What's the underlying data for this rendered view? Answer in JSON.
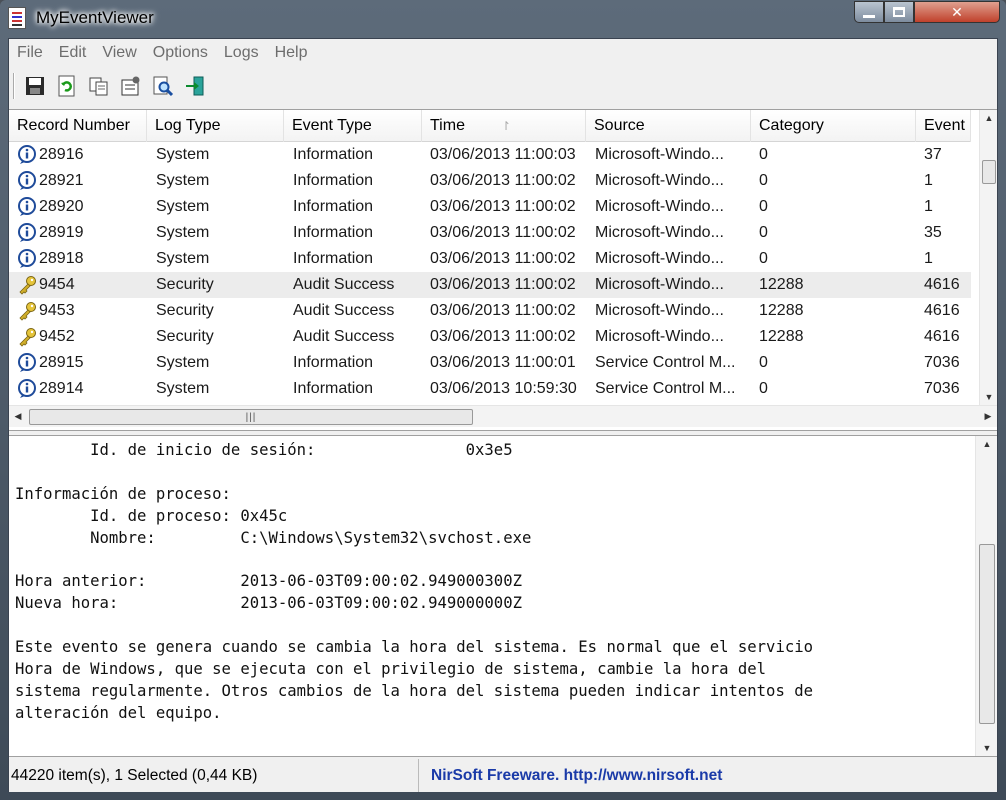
{
  "window": {
    "title": "MyEventViewer"
  },
  "menu": [
    "File",
    "Edit",
    "View",
    "Options",
    "Logs",
    "Help"
  ],
  "toolbar": [
    "save-icon",
    "refresh-icon",
    "copy-icon",
    "properties-icon",
    "find-icon",
    "exit-icon"
  ],
  "columns": [
    "Record Number",
    "Log Type",
    "Event Type",
    "Time",
    "Source",
    "Category",
    "Event ID"
  ],
  "sort_indicator": "↾",
  "rows": [
    {
      "icon": "info",
      "record": "28916",
      "log": "System",
      "event_type": "Information",
      "time": "03/06/2013 11:00:03",
      "source": "Microsoft-Windo...",
      "category": "0",
      "event_id": "37"
    },
    {
      "icon": "info",
      "record": "28921",
      "log": "System",
      "event_type": "Information",
      "time": "03/06/2013 11:00:02",
      "source": "Microsoft-Windo...",
      "category": "0",
      "event_id": "1"
    },
    {
      "icon": "info",
      "record": "28920",
      "log": "System",
      "event_type": "Information",
      "time": "03/06/2013 11:00:02",
      "source": "Microsoft-Windo...",
      "category": "0",
      "event_id": "1"
    },
    {
      "icon": "info",
      "record": "28919",
      "log": "System",
      "event_type": "Information",
      "time": "03/06/2013 11:00:02",
      "source": "Microsoft-Windo...",
      "category": "0",
      "event_id": "35"
    },
    {
      "icon": "info",
      "record": "28918",
      "log": "System",
      "event_type": "Information",
      "time": "03/06/2013 11:00:02",
      "source": "Microsoft-Windo...",
      "category": "0",
      "event_id": "1"
    },
    {
      "icon": "key",
      "record": "9454",
      "log": "Security",
      "event_type": "Audit Success",
      "time": "03/06/2013 11:00:02",
      "source": "Microsoft-Windo...",
      "category": "12288",
      "event_id": "4616",
      "selected": true
    },
    {
      "icon": "key",
      "record": "9453",
      "log": "Security",
      "event_type": "Audit Success",
      "time": "03/06/2013 11:00:02",
      "source": "Microsoft-Windo...",
      "category": "12288",
      "event_id": "4616"
    },
    {
      "icon": "key",
      "record": "9452",
      "log": "Security",
      "event_type": "Audit Success",
      "time": "03/06/2013 11:00:02",
      "source": "Microsoft-Windo...",
      "category": "12288",
      "event_id": "4616"
    },
    {
      "icon": "info",
      "record": "28915",
      "log": "System",
      "event_type": "Information",
      "time": "03/06/2013 11:00:01",
      "source": "Service Control M...",
      "category": "0",
      "event_id": "7036"
    },
    {
      "icon": "info",
      "record": "28914",
      "log": "System",
      "event_type": "Information",
      "time": "03/06/2013 10:59:30",
      "source": "Service Control M...",
      "category": "0",
      "event_id": "7036"
    }
  ],
  "detail_lines": [
    "        Id. de inicio de sesión:                0x3e5",
    "",
    "Información de proceso:",
    "        Id. de proceso: 0x45c",
    "        Nombre:         C:\\Windows\\System32\\svchost.exe",
    "",
    "Hora anterior:          2013-06-03T09:00:02.949000300Z",
    "Nueva hora:             2013-06-03T09:00:02.949000000Z",
    "",
    "Este evento se genera cuando se cambia la hora del sistema. Es normal que el servicio",
    "Hora de Windows, que se ejecuta con el privilegio de sistema, cambie la hora del",
    "sistema regularmente. Otros cambios de la hora del sistema pueden indicar intentos de",
    "alteración del equipo."
  ],
  "status": {
    "items": "44220 item(s), 1 Selected  (0,44 KB)",
    "credit": "NirSoft Freeware.  http://www.nirsoft.net"
  },
  "colors": {
    "credit": "#1a3aa8",
    "selected_row": "#ececec"
  }
}
